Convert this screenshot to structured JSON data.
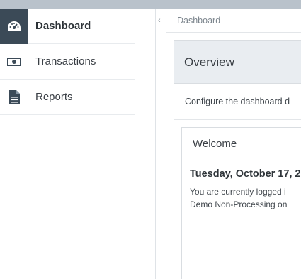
{
  "sidebar": {
    "items": [
      {
        "label": "Dashboard",
        "icon": "dashboard-gauge-icon",
        "active": true
      },
      {
        "label": "Transactions",
        "icon": "money-bill-icon",
        "active": false
      },
      {
        "label": "Reports",
        "icon": "document-icon",
        "active": false
      }
    ]
  },
  "collapse": {
    "glyph": "‹"
  },
  "breadcrumb": {
    "current": "Dashboard"
  },
  "overview": {
    "title": "Overview",
    "description": "Configure the dashboard d"
  },
  "welcome": {
    "title": "Welcome",
    "date": "Tuesday, October 17, 2",
    "line1": "You are currently logged i",
    "line2": "Demo Non-Processing on"
  },
  "colors": {
    "topbar": "#b9c2cb",
    "active_icon_bg": "#3b4a57",
    "panel_header_bg": "#e9edf1"
  }
}
